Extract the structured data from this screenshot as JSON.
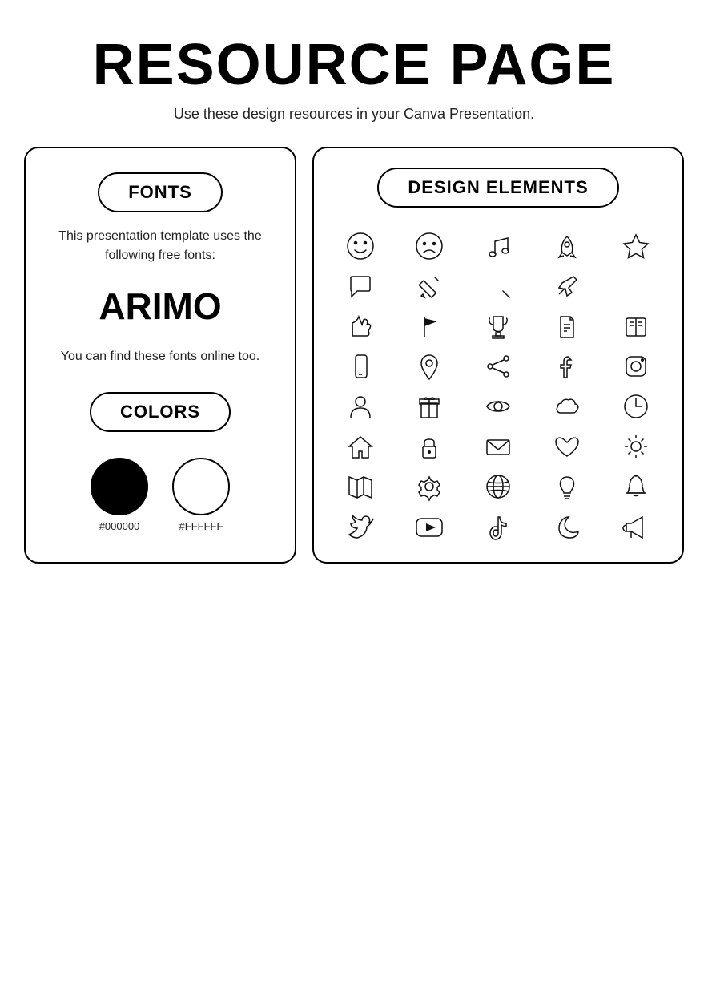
{
  "page": {
    "title": "RESOURCE PAGE",
    "subtitle": "Use these design resources in your Canva Presentation."
  },
  "left_panel": {
    "fonts_label": "FONTS",
    "fonts_description": "This presentation template uses the following free fonts:",
    "font_name": "ARIMO",
    "fonts_find": "You can find these fonts online too.",
    "colors_label": "COLORS",
    "color_swatches": [
      {
        "hex": "#000000",
        "label": "#000000",
        "bg": "#000000",
        "border": "#000"
      },
      {
        "hex": "#FFFFFF",
        "label": "#FFFFFF",
        "bg": "#FFFFFF",
        "border": "#000"
      }
    ]
  },
  "right_panel": {
    "design_elements_label": "DESIGN ELEMENTS"
  }
}
